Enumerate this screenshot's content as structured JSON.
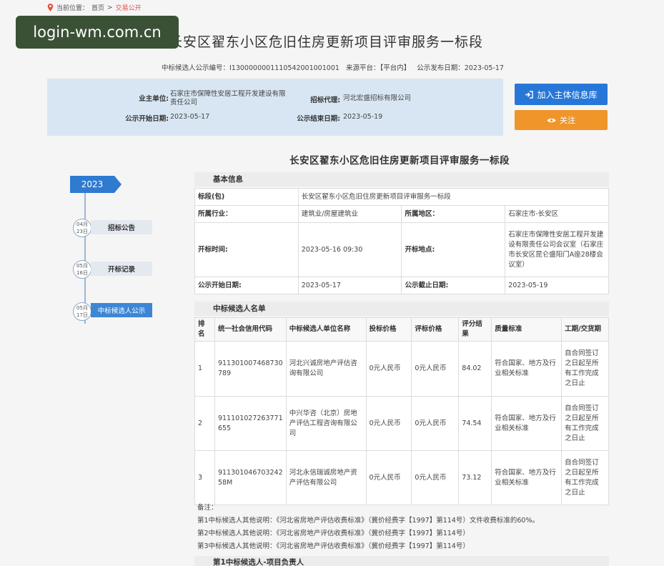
{
  "breadcrumb": {
    "label": "当前位置：",
    "home": "首页",
    "sep": ">",
    "current": "交易公开"
  },
  "watermark": "login-wm.com.cn",
  "page_title": "长安区翟东小区危旧住房更新项目评审服务一标段",
  "meta": {
    "notice_no": "中标候选人公示编号：I13000000011105420010010​01",
    "source": "来源平台：【平台内】",
    "publish_date": "公示发布日期：2023-05-17"
  },
  "info": {
    "owner_label": "业主单位:",
    "owner_value": "石家庄市保障性安居工程开发建设有限责任公司",
    "agent_label": "招标代理:",
    "agent_value": "河北宏盛招标有限公司",
    "start_label": "公示开始日期:",
    "start_value": "2023-05-17",
    "end_label": "公示结束日期:",
    "end_value": "2023-05-19"
  },
  "buttons": {
    "join": "加入主体信息库",
    "follow": "关注"
  },
  "section_title": "长安区翟东小区危旧住房更新项目评审服务一标段",
  "timeline": {
    "year": "2023",
    "items": [
      {
        "month": "04月",
        "day": "23日",
        "label": "招标公告"
      },
      {
        "month": "05月",
        "day": "16日",
        "label": "开标记录"
      },
      {
        "month": "05月",
        "day": "17日",
        "label": "中标候选人公示"
      }
    ]
  },
  "basic": {
    "head": "基本信息",
    "bid_label": "标段(包)",
    "bid_value": "长安区翟东小区危旧住房更新项目评审服务一标段",
    "industry_label": "所属行业：",
    "industry_value": "建筑业/房屋建筑业",
    "region_label": "所属地区：",
    "region_value": "石家庄市-长安区",
    "open_time_label": "开标时间:",
    "open_time_value": "2023-05-16 09:30",
    "open_place_label": "开标地点:",
    "open_place_value": "石家庄市保障性安居工程开发建设有限责任公司会议室（石家庄市长安区昆仑盛阳门A座28楼会议室）",
    "pub_start_label": "公示开始日期:",
    "pub_start_value": "2023-05-17",
    "pub_end_label": "公示截止日期:",
    "pub_end_value": "2023-05-19"
  },
  "candidates": {
    "head": "中标候选人名单",
    "columns": [
      "排名",
      "统一社会信用代码",
      "中标候选人单位名称",
      "投标价格",
      "评标价格",
      "评分结果",
      "质量标准",
      "工期/交货期"
    ],
    "rows": [
      {
        "rank": "1",
        "code": "911301007468730789",
        "name": "河北兴诚房地产评估咨询有限公司",
        "bid": "0元人民币",
        "eval": "0元人民币",
        "score": "84.02",
        "quality": "符合国家、地方及行业相关标准",
        "period": "自合同签订之日起至所有工作完成之日止"
      },
      {
        "rank": "2",
        "code": "911101027263771655",
        "name": "中兴华咨（北京）房地产评估工程咨询有限公司",
        "bid": "0元人民币",
        "eval": "0元人民币",
        "score": "74.54",
        "quality": "符合国家、地方及行业相关标准",
        "period": "自合同签订之日起至所有工作完成之日止"
      },
      {
        "rank": "3",
        "code": "91130104670324258M",
        "name": "河北永信瑞诚房地产资产评估有限公司",
        "bid": "0元人民币",
        "eval": "0元人民币",
        "score": "73.12",
        "quality": "符合国家、地方及行业相关标准",
        "period": "自合同签订之日起至所有工作完成之日止"
      }
    ]
  },
  "notes": {
    "label": "备注：",
    "lines": [
      "第1中标候选人其他说明：《河北省房地产评估收费标准》（冀价经费字【1997】第114号）文件收费标准的60%。",
      "第2中标候选人其他说明：《河北省房地产评估收费标准》（冀价经费字【1997】第114号）",
      "第3中标候选人其他说明：《河北省房地产评估收费标准》（冀价经费字【1997】第114号）"
    ]
  },
  "bottom_head": "第1中标候选人-项目负责人"
}
